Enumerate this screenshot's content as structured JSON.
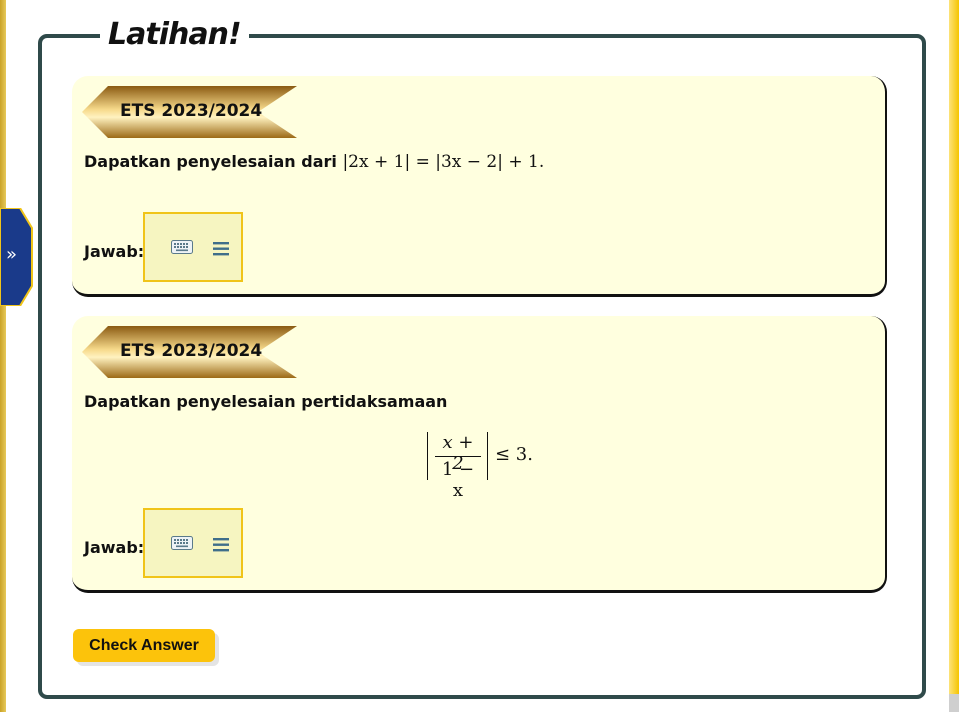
{
  "exercise": {
    "title": "Latihan!"
  },
  "side_tab": {
    "arrow": "»"
  },
  "questions": [
    {
      "badge": "ETS 2023/2024",
      "prompt": "Dapatkan penyelesaian dari",
      "math": "|2x + 1| = |3x − 2| + 1.",
      "answer_label": "Jawab:"
    },
    {
      "badge": "ETS 2023/2024",
      "prompt": "Dapatkan penyelesaian pertidaksamaan",
      "math_numerator": "x + 2",
      "math_denominator": "1 − x",
      "math_rhs": "≤ 3.",
      "answer_label": "Jawab:"
    }
  ],
  "actions": {
    "check_label": "Check Answer"
  },
  "icons": {
    "keyboard": "keyboard-icon",
    "menu": "hamburger-menu-icon",
    "expand": "double-chevron-right-icon"
  },
  "colors": {
    "frame_border": "#2f4a4a",
    "card_bg": "#ffffdf",
    "answer_border": "#f0c419",
    "button": "#fcc30b",
    "side_tab": "#1a3a8a"
  }
}
